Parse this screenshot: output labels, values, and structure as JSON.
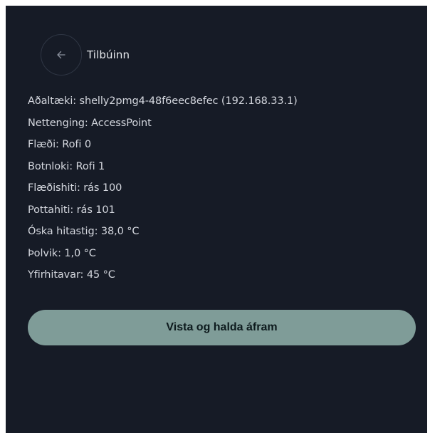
{
  "header": {
    "back_icon": "arrow-left-icon",
    "title": "Tilbúinn"
  },
  "info": [
    "Aðaltæki: shelly2pmg4-48f6eec8efec (192.168.33.1)",
    "Nettenging: AccessPoint",
    "Flæði: Rofi 0",
    "Botnloki: Rofi 1",
    "Flæðishiti: rás 100",
    "Pottahiti: rás 101",
    "Óska hitastig: 38,0 °C",
    "Þolvik: 1,0 °C",
    "Yfirhitavar: 45 °C"
  ],
  "actions": {
    "save_label": "Vista og halda áfram"
  },
  "colors": {
    "background": "#161b26",
    "primary_button": "#7f9c98",
    "text": "#d4d7de"
  }
}
